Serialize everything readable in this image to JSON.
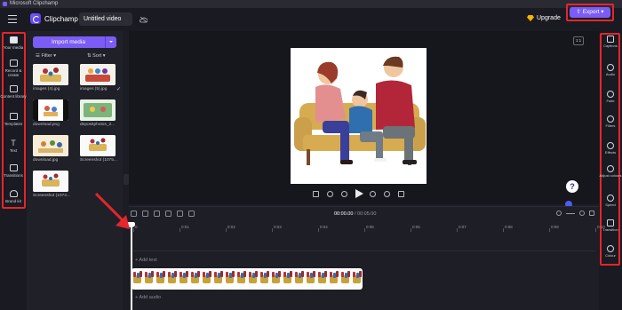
{
  "window": {
    "title": "Microsoft Clipchamp"
  },
  "topbar": {
    "brand": "Clipchamp",
    "video_title": "Untitled video",
    "upgrade_label": "Upgrade",
    "export_label": "Export"
  },
  "left_rail": {
    "items": [
      {
        "label": "Your media",
        "icon": "folder-icon"
      },
      {
        "label": "Record & create",
        "icon": "camera-icon"
      },
      {
        "label": "Content library",
        "icon": "library-icon"
      },
      {
        "label": "Templates",
        "icon": "templates-icon"
      },
      {
        "label": "Text",
        "icon": "text-icon"
      },
      {
        "label": "Transitions",
        "icon": "transitions-icon"
      },
      {
        "label": "Brand kit",
        "icon": "brand-kit-icon"
      }
    ]
  },
  "media": {
    "import_label": "Import media",
    "filter_label": "Filter",
    "sort_label": "Sort",
    "items": [
      {
        "name": "images (4).jpg"
      },
      {
        "name": "images (5).jpg"
      },
      {
        "name": "download.png"
      },
      {
        "name": "depositphotos_2..."
      },
      {
        "name": "download.jpg"
      },
      {
        "name": "Screenshot (1075..."
      },
      {
        "name": "Screenshot (1074..."
      }
    ]
  },
  "preview": {
    "aspect_ratio": "1:1"
  },
  "right_rail": {
    "items": [
      {
        "label": "Captions"
      },
      {
        "label": "Audio"
      },
      {
        "label": "Fade"
      },
      {
        "label": "Filters"
      },
      {
        "label": "Effects"
      },
      {
        "label": "Adjust colours"
      },
      {
        "label": "Speed"
      },
      {
        "label": "Transition"
      },
      {
        "label": "Colour"
      }
    ]
  },
  "timeline": {
    "current_time": "00:00.00",
    "total_time": "/ 00:05.00",
    "ticks": [
      "0",
      "0:01",
      "0:02",
      "0:03",
      "0:04",
      "0:05",
      "0:06",
      "0:07",
      "0:08",
      "0:09",
      "0:10"
    ],
    "add_text": "+ Add text",
    "add_audio": "+ Add audio"
  },
  "colors": {
    "accent": "#7b5cf6",
    "highlight": "#e5262b",
    "background": "#1c1c24"
  }
}
